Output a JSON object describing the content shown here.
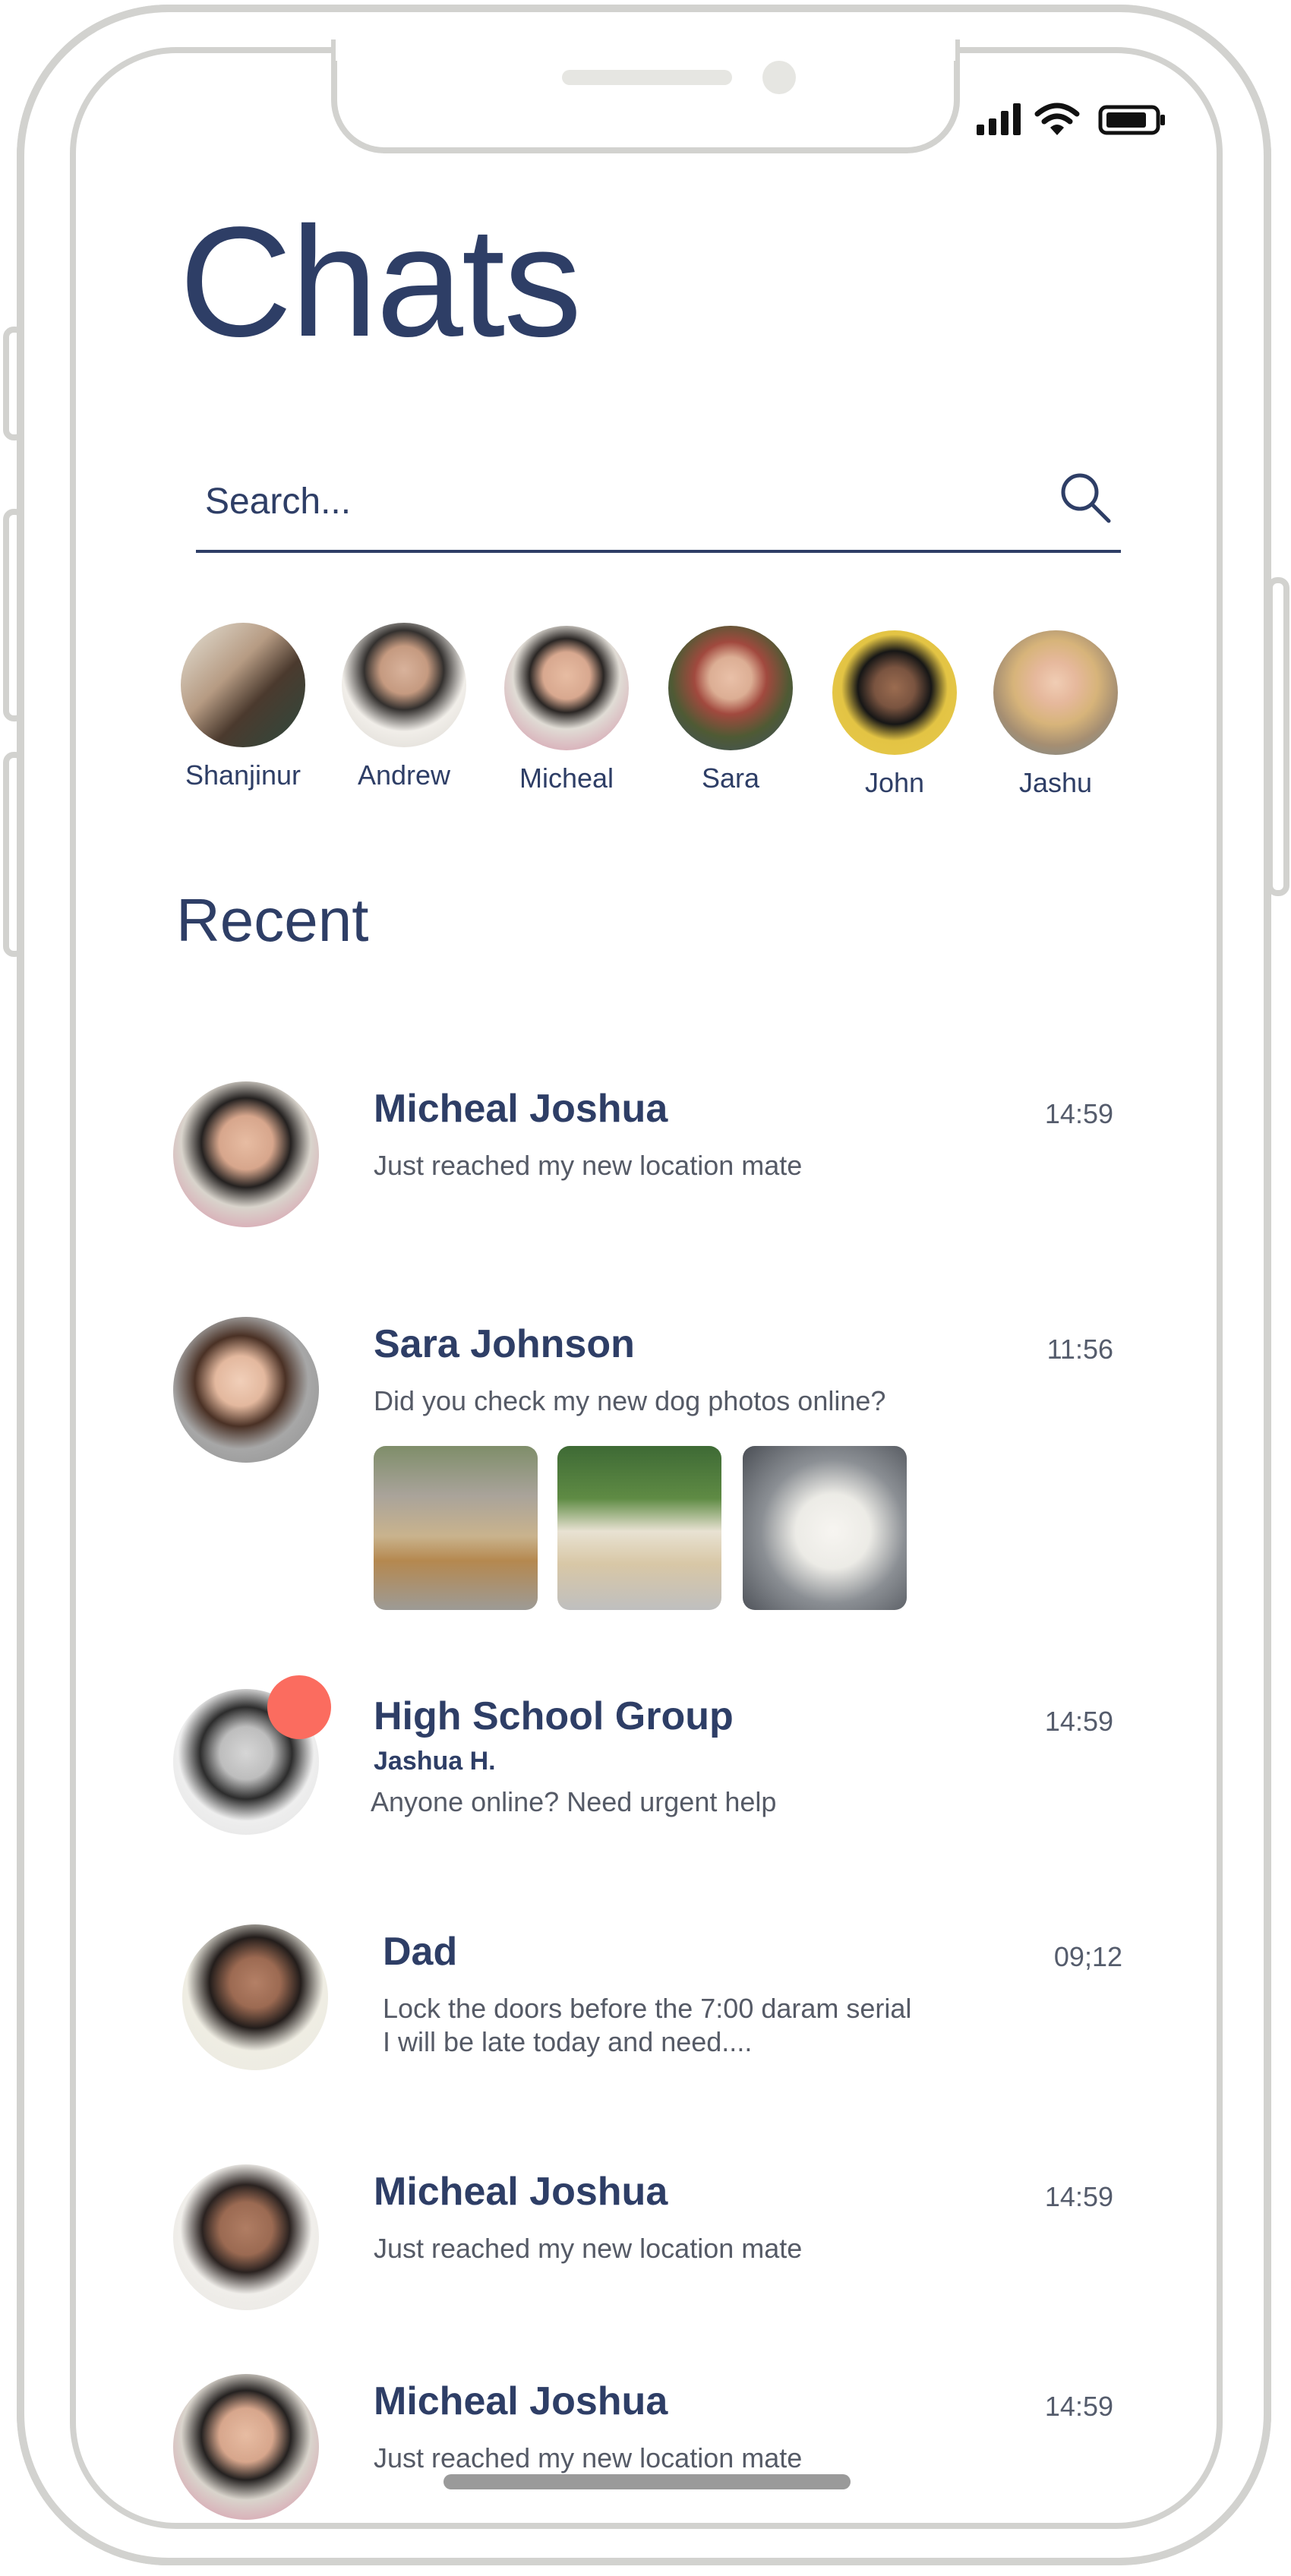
{
  "status_bar": {
    "signal_icon": "signal-bars-icon",
    "wifi_icon": "wifi-icon",
    "battery_icon": "battery-icon"
  },
  "header": {
    "title": "Chats"
  },
  "search": {
    "placeholder": "Search...",
    "value": "",
    "icon": "search-icon"
  },
  "stories": [
    {
      "name": "Shanjinur"
    },
    {
      "name": "Andrew"
    },
    {
      "name": "Micheal"
    },
    {
      "name": "Sara"
    },
    {
      "name": "John"
    },
    {
      "name": "Jashu"
    }
  ],
  "recent": {
    "title": "Recent",
    "chats": [
      {
        "name": "Micheal Joshua",
        "time": "14:59",
        "message": "Just reached my new location mate"
      },
      {
        "name": "Sara Johnson",
        "time": "11:56",
        "message": "Did you check my new dog photos online?",
        "attachments": 3
      },
      {
        "name": "High School Group",
        "time": "14:59",
        "sender": "Jashua H.",
        "message": "Anyone online? Need urgent help",
        "unread": true
      },
      {
        "name": "Dad",
        "time": "09;12",
        "message_line1": "Lock the doors before the 7:00 daram serial",
        "message_line2": "I will be late today and need...."
      },
      {
        "name": "Micheal Joshua",
        "time": "14:59",
        "message": "Just reached my new location mate"
      },
      {
        "name": "Micheal Joshua",
        "time": "14:59",
        "message": "Just reached my new location mate"
      }
    ]
  },
  "colors": {
    "primary": "#2e3e66",
    "unread_badge": "#fb6c5f",
    "frame": "#d2d2cf"
  }
}
